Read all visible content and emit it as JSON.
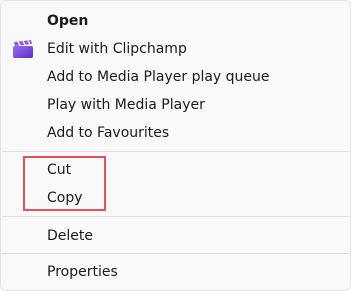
{
  "menu": {
    "items": [
      {
        "label": "Open",
        "bold": true
      },
      {
        "label": "Edit with Clipchamp",
        "icon": "clipchamp-icon"
      },
      {
        "label": "Add to Media Player play queue"
      },
      {
        "label": "Play with Media Player"
      },
      {
        "label": "Add to Favourites"
      }
    ],
    "group2": [
      {
        "label": "Cut"
      },
      {
        "label": "Copy"
      }
    ],
    "group3": [
      {
        "label": "Delete"
      }
    ],
    "group4": [
      {
        "label": "Properties"
      }
    ]
  },
  "colors": {
    "highlight_border": "#e2545c",
    "clipchamp_purple": "#7b4fe0"
  }
}
